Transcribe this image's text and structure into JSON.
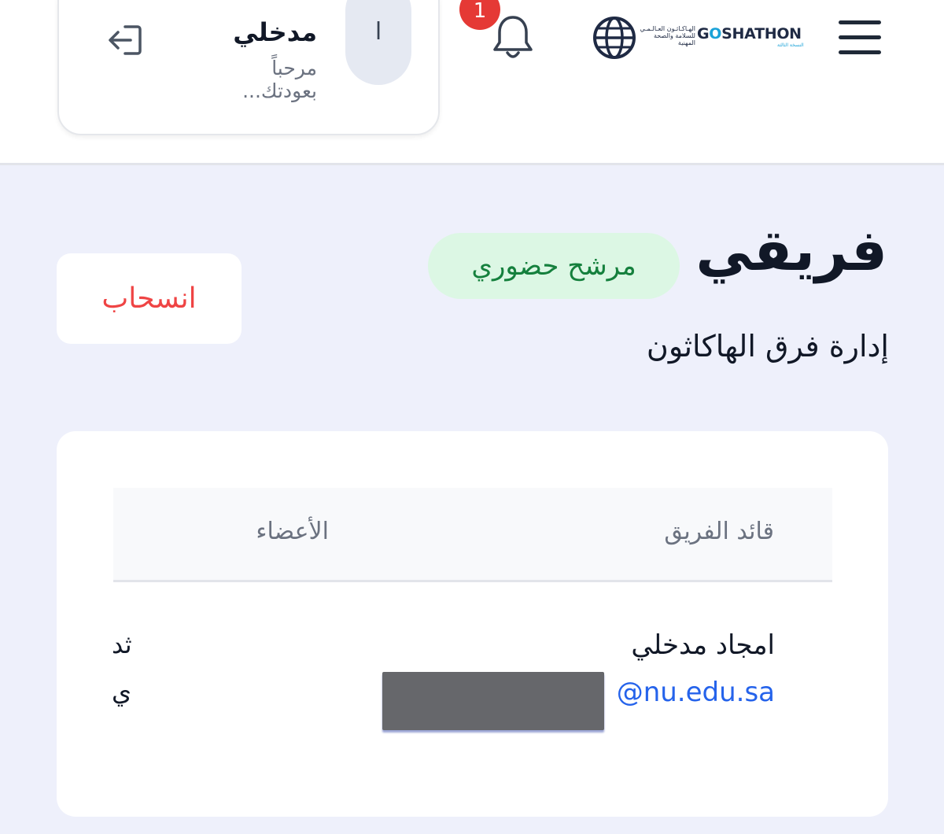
{
  "header": {
    "menu_icon": "hamburger-menu-icon",
    "logo": {
      "brand_prefix": "G",
      "brand_o": "O",
      "brand_suffix": "SHATHON",
      "arabic_line1": "الهـاكـاثـون العـالـمـي",
      "arabic_line2": "للسلامة والصحة المهنية",
      "edition": "النسخة الثالثة",
      "icon": "globe-icon"
    },
    "notifications": {
      "icon": "bell-icon",
      "count": "1",
      "badge_color": "#e53935"
    },
    "user": {
      "avatar_initial": "ا",
      "name": "مدخلي",
      "greeting_line1": "مرحباً",
      "greeting_line2": "بعودتك..."
    },
    "logout_icon": "logout-icon"
  },
  "page": {
    "title": "فريقي",
    "status_badge": "مرشح حضوري",
    "subtitle": "إدارة فرق الهاكاثون",
    "withdraw_label": "انسحاب"
  },
  "team_table": {
    "columns": [
      "قائد الفريق",
      "الأعضاء"
    ],
    "rows": [
      {
        "leader_name": "امجاد مدخلي",
        "leader_email": "@nu.edu.sa",
        "member_fragment_1": "ثد",
        "member_fragment_2": "ي"
      }
    ]
  },
  "colors": {
    "accent_red": "#ef4444",
    "status_green": "#15803d",
    "status_bg": "#dcf7e4",
    "link_blue": "#2563eb",
    "page_bg": "#eef0fb"
  }
}
